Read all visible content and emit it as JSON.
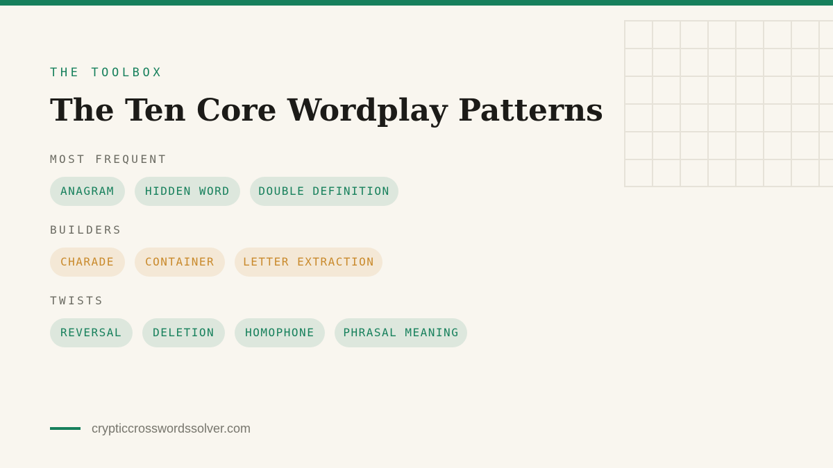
{
  "header": {
    "eyebrow": "THE TOOLBOX",
    "title": "The Ten Core Wordplay Patterns"
  },
  "groups": [
    {
      "label": "MOST FREQUENT",
      "color": "green",
      "items": [
        "ANAGRAM",
        "HIDDEN WORD",
        "DOUBLE DEFINITION"
      ]
    },
    {
      "label": "BUILDERS",
      "color": "amber",
      "items": [
        "CHARADE",
        "CONTAINER",
        "LETTER EXTRACTION"
      ]
    },
    {
      "label": "TWISTS",
      "color": "green",
      "items": [
        "REVERSAL",
        "DELETION",
        "HOMOPHONE",
        "PHRASAL MEANING"
      ]
    }
  ],
  "footer": {
    "site": "crypticcrosswordssolver.com"
  },
  "colors": {
    "accent": "#17805c",
    "amber": "#c98a2c",
    "background": "#f9f6ef"
  }
}
